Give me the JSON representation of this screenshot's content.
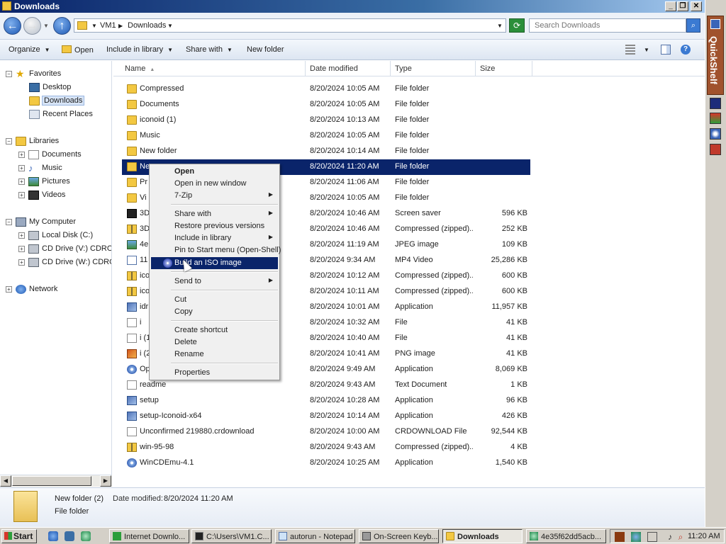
{
  "window": {
    "title": "Downloads",
    "caption_buttons": [
      "_",
      "❐",
      "✕"
    ]
  },
  "address": {
    "crumbs": [
      "VM1",
      "Downloads"
    ],
    "search_placeholder": "Search Downloads"
  },
  "toolbar": {
    "organize": "Organize",
    "open": "Open",
    "include_in_library": "Include in library",
    "share_with": "Share with",
    "new_folder": "New folder"
  },
  "nav": {
    "favorites": "Favorites",
    "desktop": "Desktop",
    "downloads": "Downloads",
    "recent_places": "Recent Places",
    "libraries": "Libraries",
    "documents": "Documents",
    "music": "Music",
    "pictures": "Pictures",
    "videos": "Videos",
    "my_computer": "My Computer",
    "local_disk": "Local Disk (C:)",
    "cd_drive_v": "CD Drive (V:) CDROM",
    "cd_drive_w": "CD Drive (W:) CDROM",
    "network": "Network"
  },
  "columns": {
    "name": "Name",
    "date_modified": "Date modified",
    "type": "Type",
    "size": "Size"
  },
  "files": [
    {
      "name": "Compressed",
      "date": "8/20/2024 10:05 AM",
      "type": "File folder",
      "size": "",
      "icon": "folder-icon"
    },
    {
      "name": "Documents",
      "date": "8/20/2024 10:05 AM",
      "type": "File folder",
      "size": "",
      "icon": "folder-icon"
    },
    {
      "name": "iconoid (1)",
      "date": "8/20/2024 10:13 AM",
      "type": "File folder",
      "size": "",
      "icon": "folder-icon"
    },
    {
      "name": "Music",
      "date": "8/20/2024 10:05 AM",
      "type": "File folder",
      "size": "",
      "icon": "folder-icon"
    },
    {
      "name": "New folder",
      "date": "8/20/2024 10:14 AM",
      "type": "File folder",
      "size": "",
      "icon": "folder-icon"
    },
    {
      "name": "Ne",
      "date": "8/20/2024 11:20 AM",
      "type": "File folder",
      "size": "",
      "icon": "folder-icon"
    },
    {
      "name": "Pr",
      "date": "8/20/2024 11:06 AM",
      "type": "File folder",
      "size": "",
      "icon": "folder-icon"
    },
    {
      "name": "Vi",
      "date": "8/20/2024 10:05 AM",
      "type": "File folder",
      "size": "",
      "icon": "folder-icon"
    },
    {
      "name": "3D",
      "date": "8/20/2024 10:46 AM",
      "type": "Screen saver",
      "size": "596 KB",
      "icon": "screensaver-icon"
    },
    {
      "name": "3D",
      "date": "8/20/2024 10:46 AM",
      "type": "Compressed (zipped)...",
      "size": "252 KB",
      "icon": "zip-icon"
    },
    {
      "name": "4e",
      "date": "8/20/2024 11:19 AM",
      "type": "JPEG image",
      "size": "109 KB",
      "icon": "image-icon"
    },
    {
      "name": "11",
      "date": "8/20/2024 9:34 AM",
      "type": "MP4 Video",
      "size": "25,286 KB",
      "icon": "video-icon"
    },
    {
      "name": "ico",
      "date": "8/20/2024 10:12 AM",
      "type": "Compressed (zipped)...",
      "size": "600 KB",
      "icon": "zip-icon"
    },
    {
      "name": "ico",
      "date": "8/20/2024 10:11 AM",
      "type": "Compressed (zipped)...",
      "size": "600 KB",
      "icon": "zip-icon"
    },
    {
      "name": "idr",
      "date": "8/20/2024 10:01 AM",
      "type": "Application",
      "size": "11,957 KB",
      "icon": "app-icon"
    },
    {
      "name": "i",
      "date": "8/20/2024 10:32 AM",
      "type": "File",
      "size": "41 KB",
      "icon": "file-icon"
    },
    {
      "name": "i (1",
      "date": "8/20/2024 10:40 AM",
      "type": "File",
      "size": "41 KB",
      "icon": "file-icon"
    },
    {
      "name": "i (2",
      "date": "8/20/2024 10:41 AM",
      "type": "PNG image",
      "size": "41 KB",
      "icon": "png-icon"
    },
    {
      "name": "Op",
      "date": "8/20/2024 9:49 AM",
      "type": "Application",
      "size": "8,069 KB",
      "icon": "disc-icon"
    },
    {
      "name": "readme",
      "date": "8/20/2024 9:43 AM",
      "type": "Text Document",
      "size": "1 KB",
      "icon": "file-icon"
    },
    {
      "name": "setup",
      "date": "8/20/2024 10:28 AM",
      "type": "Application",
      "size": "96 KB",
      "icon": "app-icon"
    },
    {
      "name": "setup-Iconoid-x64",
      "date": "8/20/2024 10:14 AM",
      "type": "Application",
      "size": "426 KB",
      "icon": "app-icon"
    },
    {
      "name": "Unconfirmed 219880.crdownload",
      "date": "8/20/2024 10:00 AM",
      "type": "CRDOWNLOAD File",
      "size": "92,544 KB",
      "icon": "file-icon"
    },
    {
      "name": "win-95-98",
      "date": "8/20/2024 9:43 AM",
      "type": "Compressed (zipped)...",
      "size": "4 KB",
      "icon": "zip-icon"
    },
    {
      "name": "WinCDEmu-4.1",
      "date": "8/20/2024 10:25 AM",
      "type": "Application",
      "size": "1,540 KB",
      "icon": "disc-icon"
    }
  ],
  "context_menu": {
    "open": "Open",
    "open_new_window": "Open in new window",
    "seven_zip": "7-Zip",
    "share_with": "Share with",
    "restore_previous": "Restore previous versions",
    "include_in_library": "Include in library",
    "pin_to_start": "Pin to Start menu (Open-Shell)",
    "build_iso": "Build an ISO image",
    "send_to": "Send to",
    "cut": "Cut",
    "copy": "Copy",
    "create_shortcut": "Create shortcut",
    "delete": "Delete",
    "rename": "Rename",
    "properties": "Properties"
  },
  "details": {
    "name": "New folder (2)",
    "modified_label": "Date modified:",
    "modified_value": "8/20/2024 11:20 AM",
    "type": "File folder"
  },
  "quickshelf": {
    "label": "QuickShelf"
  },
  "taskbar": {
    "start": "Start",
    "tasks": [
      "Internet Downlo...",
      "C:\\Users\\VM1.C...",
      "autorun - Notepad",
      "On-Screen Keyb...",
      "Downloads",
      "4e35f62dd5acb..."
    ],
    "clock": "11:20 AM"
  },
  "colors": {
    "selection": "#0a246a",
    "title_gradient_start": "#0a246a",
    "folder": "#f3c842"
  }
}
